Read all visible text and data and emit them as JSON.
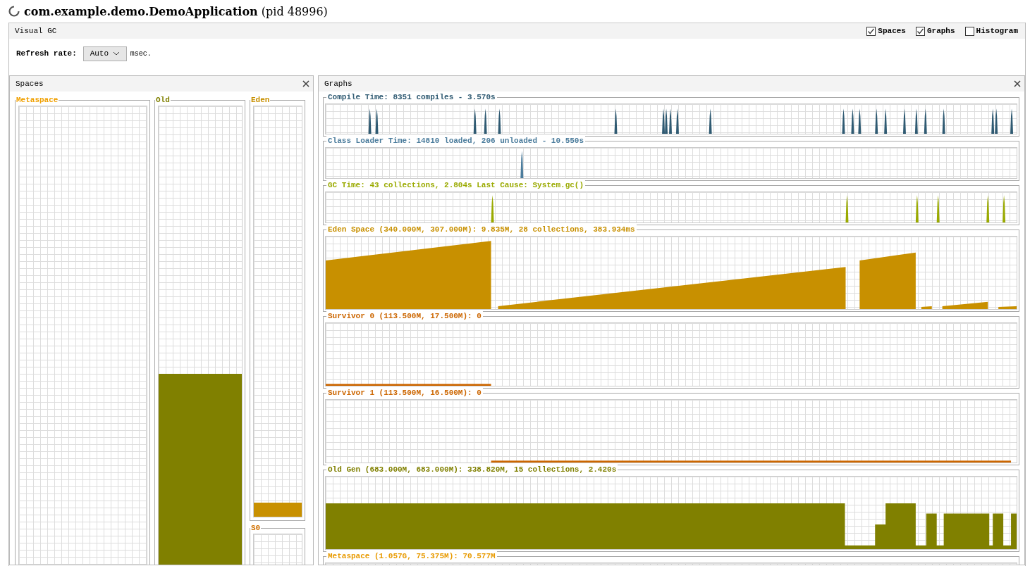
{
  "window": {
    "title": "**com.example.demo.DemoApplication** (pid 48996)"
  },
  "tab": {
    "label": "Visual GC"
  },
  "options": [
    {
      "label": "Spaces",
      "checked": true
    },
    {
      "label": "Graphs",
      "checked": true
    },
    {
      "label": "Histogram",
      "checked": false
    }
  ],
  "refresh": {
    "label": "Refresh rate:",
    "value": "Auto",
    "unit": "msec."
  },
  "spaces_panel": {
    "title": "Spaces",
    "columns": [
      [
        {
          "name": "Metaspace",
          "color": "#f0a000"
        }
      ],
      [
        {
          "name": "Old",
          "color": "#808000",
          "level": 0.44
        }
      ],
      [
        {
          "name": "Eden",
          "color": "#c89000",
          "level": 0.034
        },
        {
          "name": "S0",
          "color": "#d07000"
        }
      ]
    ]
  },
  "graphs_panel": {
    "title": "Graphs",
    "graphs": [
      {
        "kind": "spikes",
        "color": "#2f5a72",
        "title": "Compile Time: 8351 compiles - 3.570s"
      },
      {
        "kind": "spikes",
        "color": "#4b7c9c",
        "title": "Class Loader Time: 14810 loaded, 206 unloaded - 10.550s"
      },
      {
        "kind": "spikes",
        "color": "#9aaa00",
        "title": "GC Time: 43 collections, 2.804s  Last Cause: System.gc()"
      },
      {
        "kind": "area",
        "color": "#c89000",
        "title": "Eden Space (340.000M, 307.000M): 9.835M, 28 collections, 383.934ms"
      },
      {
        "kind": "line",
        "color": "#cc6600",
        "title": "Survivor 0 (113.500M, 17.500M): 0"
      },
      {
        "kind": "line",
        "color": "#cc6600",
        "title": "Survivor 1 (113.500M, 16.500M): 0"
      },
      {
        "kind": "area",
        "color": "#808000",
        "title": "Old Gen (683.000M, 683.000M): 338.820M, 15 collections, 2.420s"
      },
      {
        "kind": "area",
        "color": "#e89a00",
        "title": "Metaspace (1.057G, 75.375M): 70.577M"
      }
    ]
  }
}
